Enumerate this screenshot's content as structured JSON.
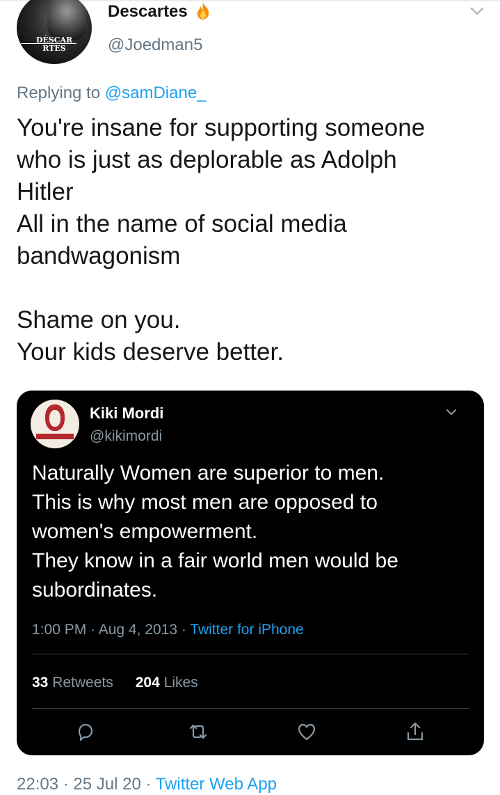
{
  "tweet": {
    "author": {
      "display_name": "Descartes",
      "name_emoji": "fire-emoji",
      "handle": "@Joedman5",
      "avatar_text": "DÉSCAR\nRTES"
    },
    "reply": {
      "prefix": "Replying to ",
      "mention": "@samDiane_"
    },
    "text": "You're insane for supporting someone\nwho is just as deplorable as Adolph\nHitler\nAll in the name of social media\nbandwagonism\n\nShame on you.\nYour kids deserve better.",
    "menu_icon": "chevron-down-icon",
    "time": "22:03",
    "date": "25 Jul 20",
    "source": "Twitter Web App",
    "separator": " · "
  },
  "quote": {
    "author": {
      "display_name": "Kiki Mordi",
      "handle": "@kikimordi"
    },
    "text": " Naturally Women are superior to men.\nThis is why most men are opposed to\nwomen's empowerment.\nThey know in a fair world men would be\nsubordinates.",
    "time": "1:00 PM",
    "date": "Aug 4, 2013",
    "source": "Twitter for iPhone",
    "separator": " · ",
    "retweets_count": "33",
    "retweets_label": "Retweets",
    "likes_count": "204",
    "likes_label": "Likes",
    "actions": [
      "reply-icon",
      "retweet-icon",
      "like-icon",
      "share-icon"
    ]
  },
  "colors": {
    "accent": "#1da1f2",
    "text": "#14171a",
    "muted": "#657786",
    "quote_bg": "#000000"
  }
}
